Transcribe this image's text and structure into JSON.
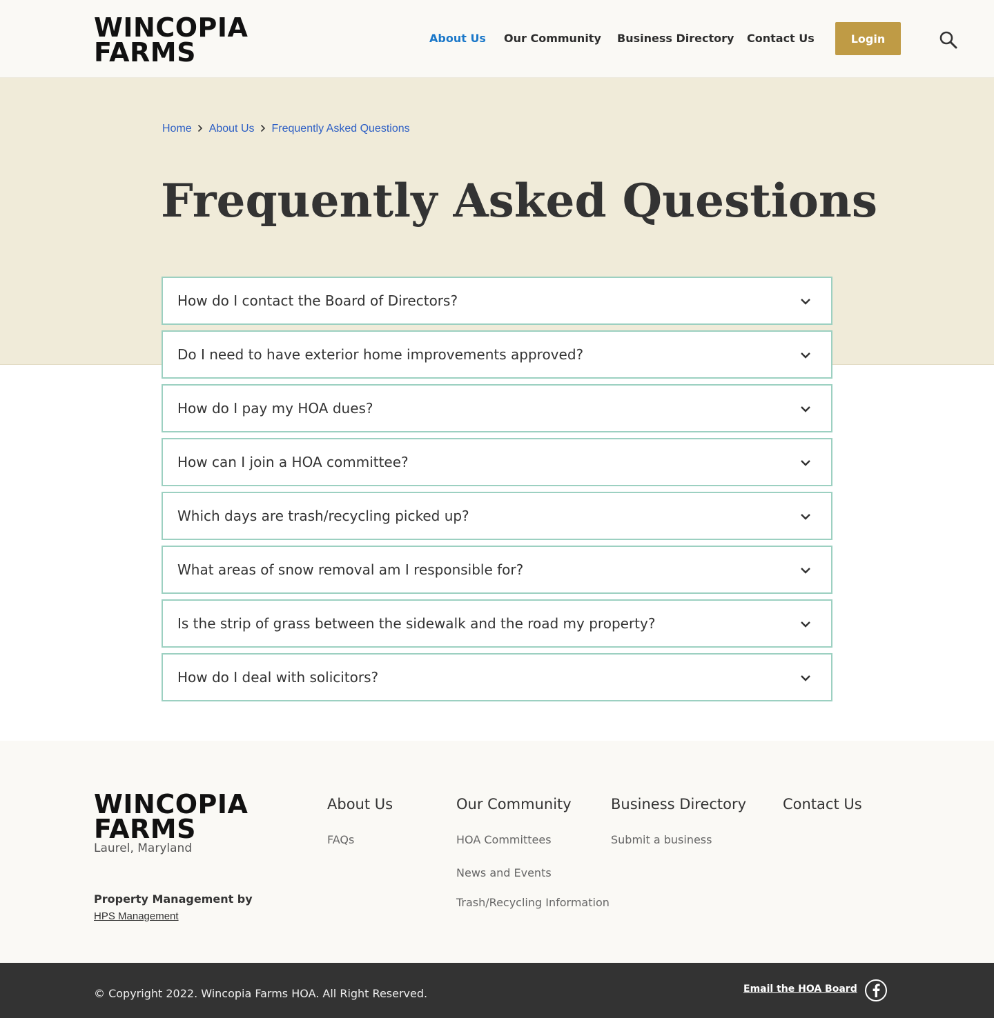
{
  "brand": {
    "name_line1": "WINCOPIA",
    "name_line2": "FARMS",
    "location": "Laurel, Maryland"
  },
  "nav": {
    "items": [
      {
        "label": "About Us",
        "active": true
      },
      {
        "label": "Our Community",
        "active": false
      },
      {
        "label": "Business Directory",
        "active": false
      },
      {
        "label": "Contact Us",
        "active": false
      }
    ],
    "login_label": "Login",
    "search_icon": "search-icon"
  },
  "breadcrumb": [
    "Home",
    "About Us",
    "Frequently Asked Questions"
  ],
  "page_title": "Frequently Asked Questions",
  "faqs": [
    "How do I contact the Board of Directors?",
    "Do I need to have exterior home improvements approved?",
    "How do I pay my HOA dues?",
    "How can I join a HOA committee?",
    "Which days are trash/recycling picked up?",
    "What areas of snow removal am I responsible for?",
    "Is the strip of grass between the sidewalk and the road my property?",
    "How do I deal with solicitors?"
  ],
  "footer": {
    "columns": [
      {
        "heading": "About Us",
        "links": [
          "FAQs"
        ]
      },
      {
        "heading": "Our Community",
        "links": [
          "HOA Committees",
          "News and Events",
          "Trash/Recycling Information"
        ]
      },
      {
        "heading": "Business Directory",
        "links": [
          "Submit a business"
        ]
      },
      {
        "heading": "Contact Us",
        "links": []
      }
    ],
    "pm_label": "Property Management by",
    "pm_link": "HPS Management",
    "copyright": "© Copyright 2022. Wincopia Farms HOA. All Right Reserved.",
    "email_link": "Email the HOA Board",
    "social_icon": "facebook-icon"
  },
  "colors": {
    "accent_gold": "#bf9b45",
    "active_nav": "#1b78c9",
    "hero_bg": "#f0ebd9",
    "faq_border": "#9cd0c1",
    "bottom_bar": "#333333"
  }
}
